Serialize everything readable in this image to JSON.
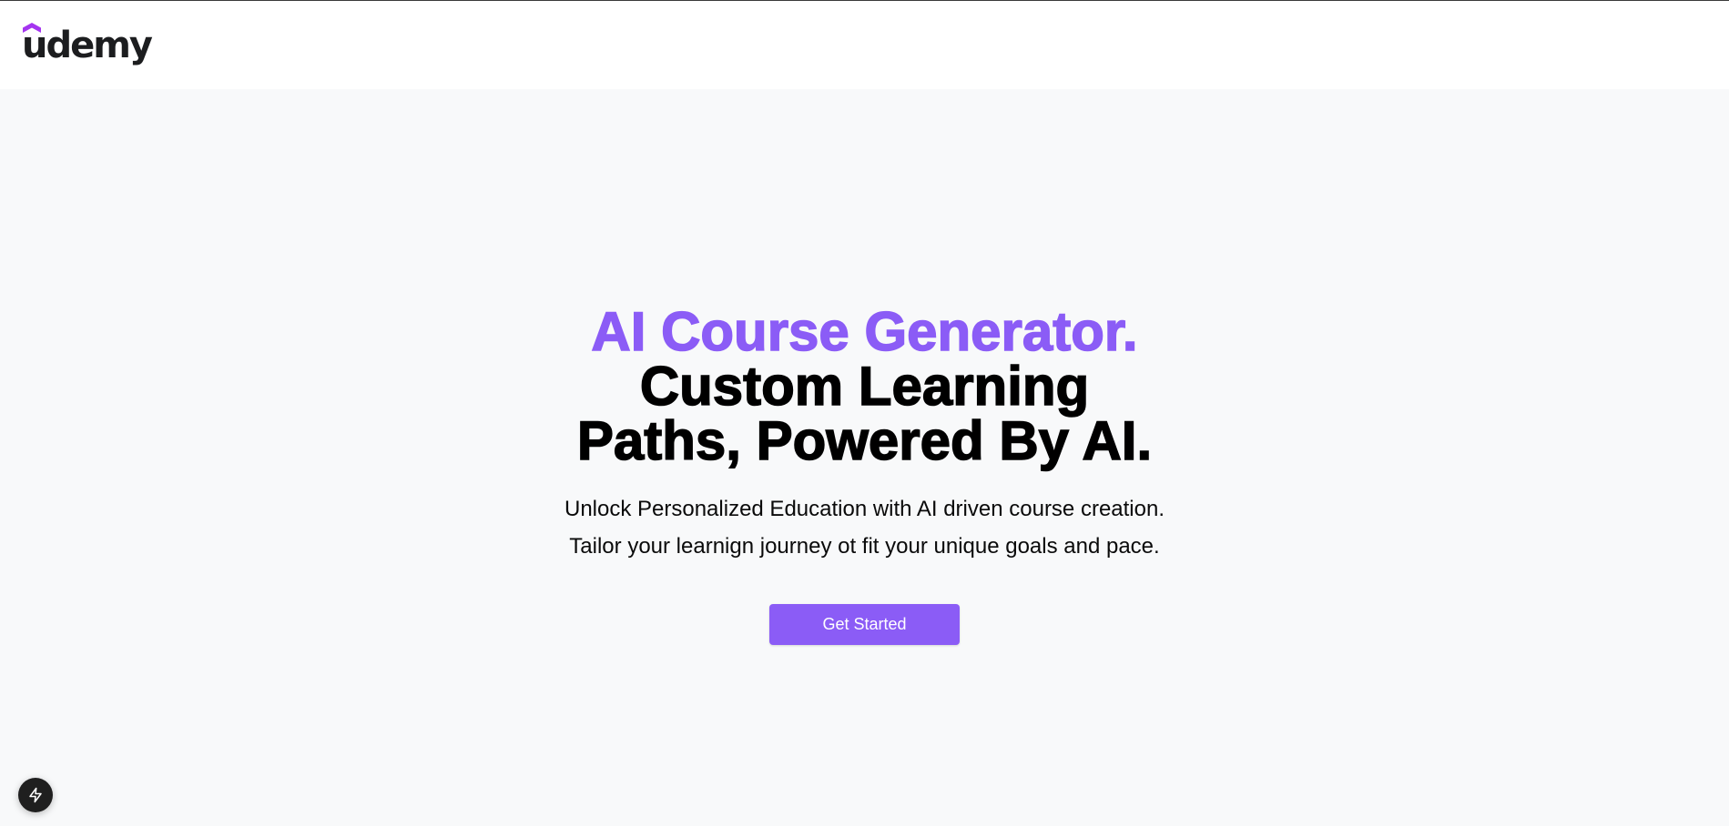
{
  "header": {
    "logo_text": "udemy",
    "logo_accent_color": "#a435f0"
  },
  "hero": {
    "title_accent": "AI Course Generator.",
    "title_rest": "Custom Learning Paths, Powered By AI.",
    "subtitle_line1": "Unlock Personalized Education with AI driven course creation.",
    "subtitle_line2": "Tailor your learnign journey ot fit your unique goals and pace.",
    "cta_label": "Get Started",
    "accent_color": "#8b5cf6"
  },
  "floating_button": {
    "icon": "lightning-bolt-icon"
  }
}
